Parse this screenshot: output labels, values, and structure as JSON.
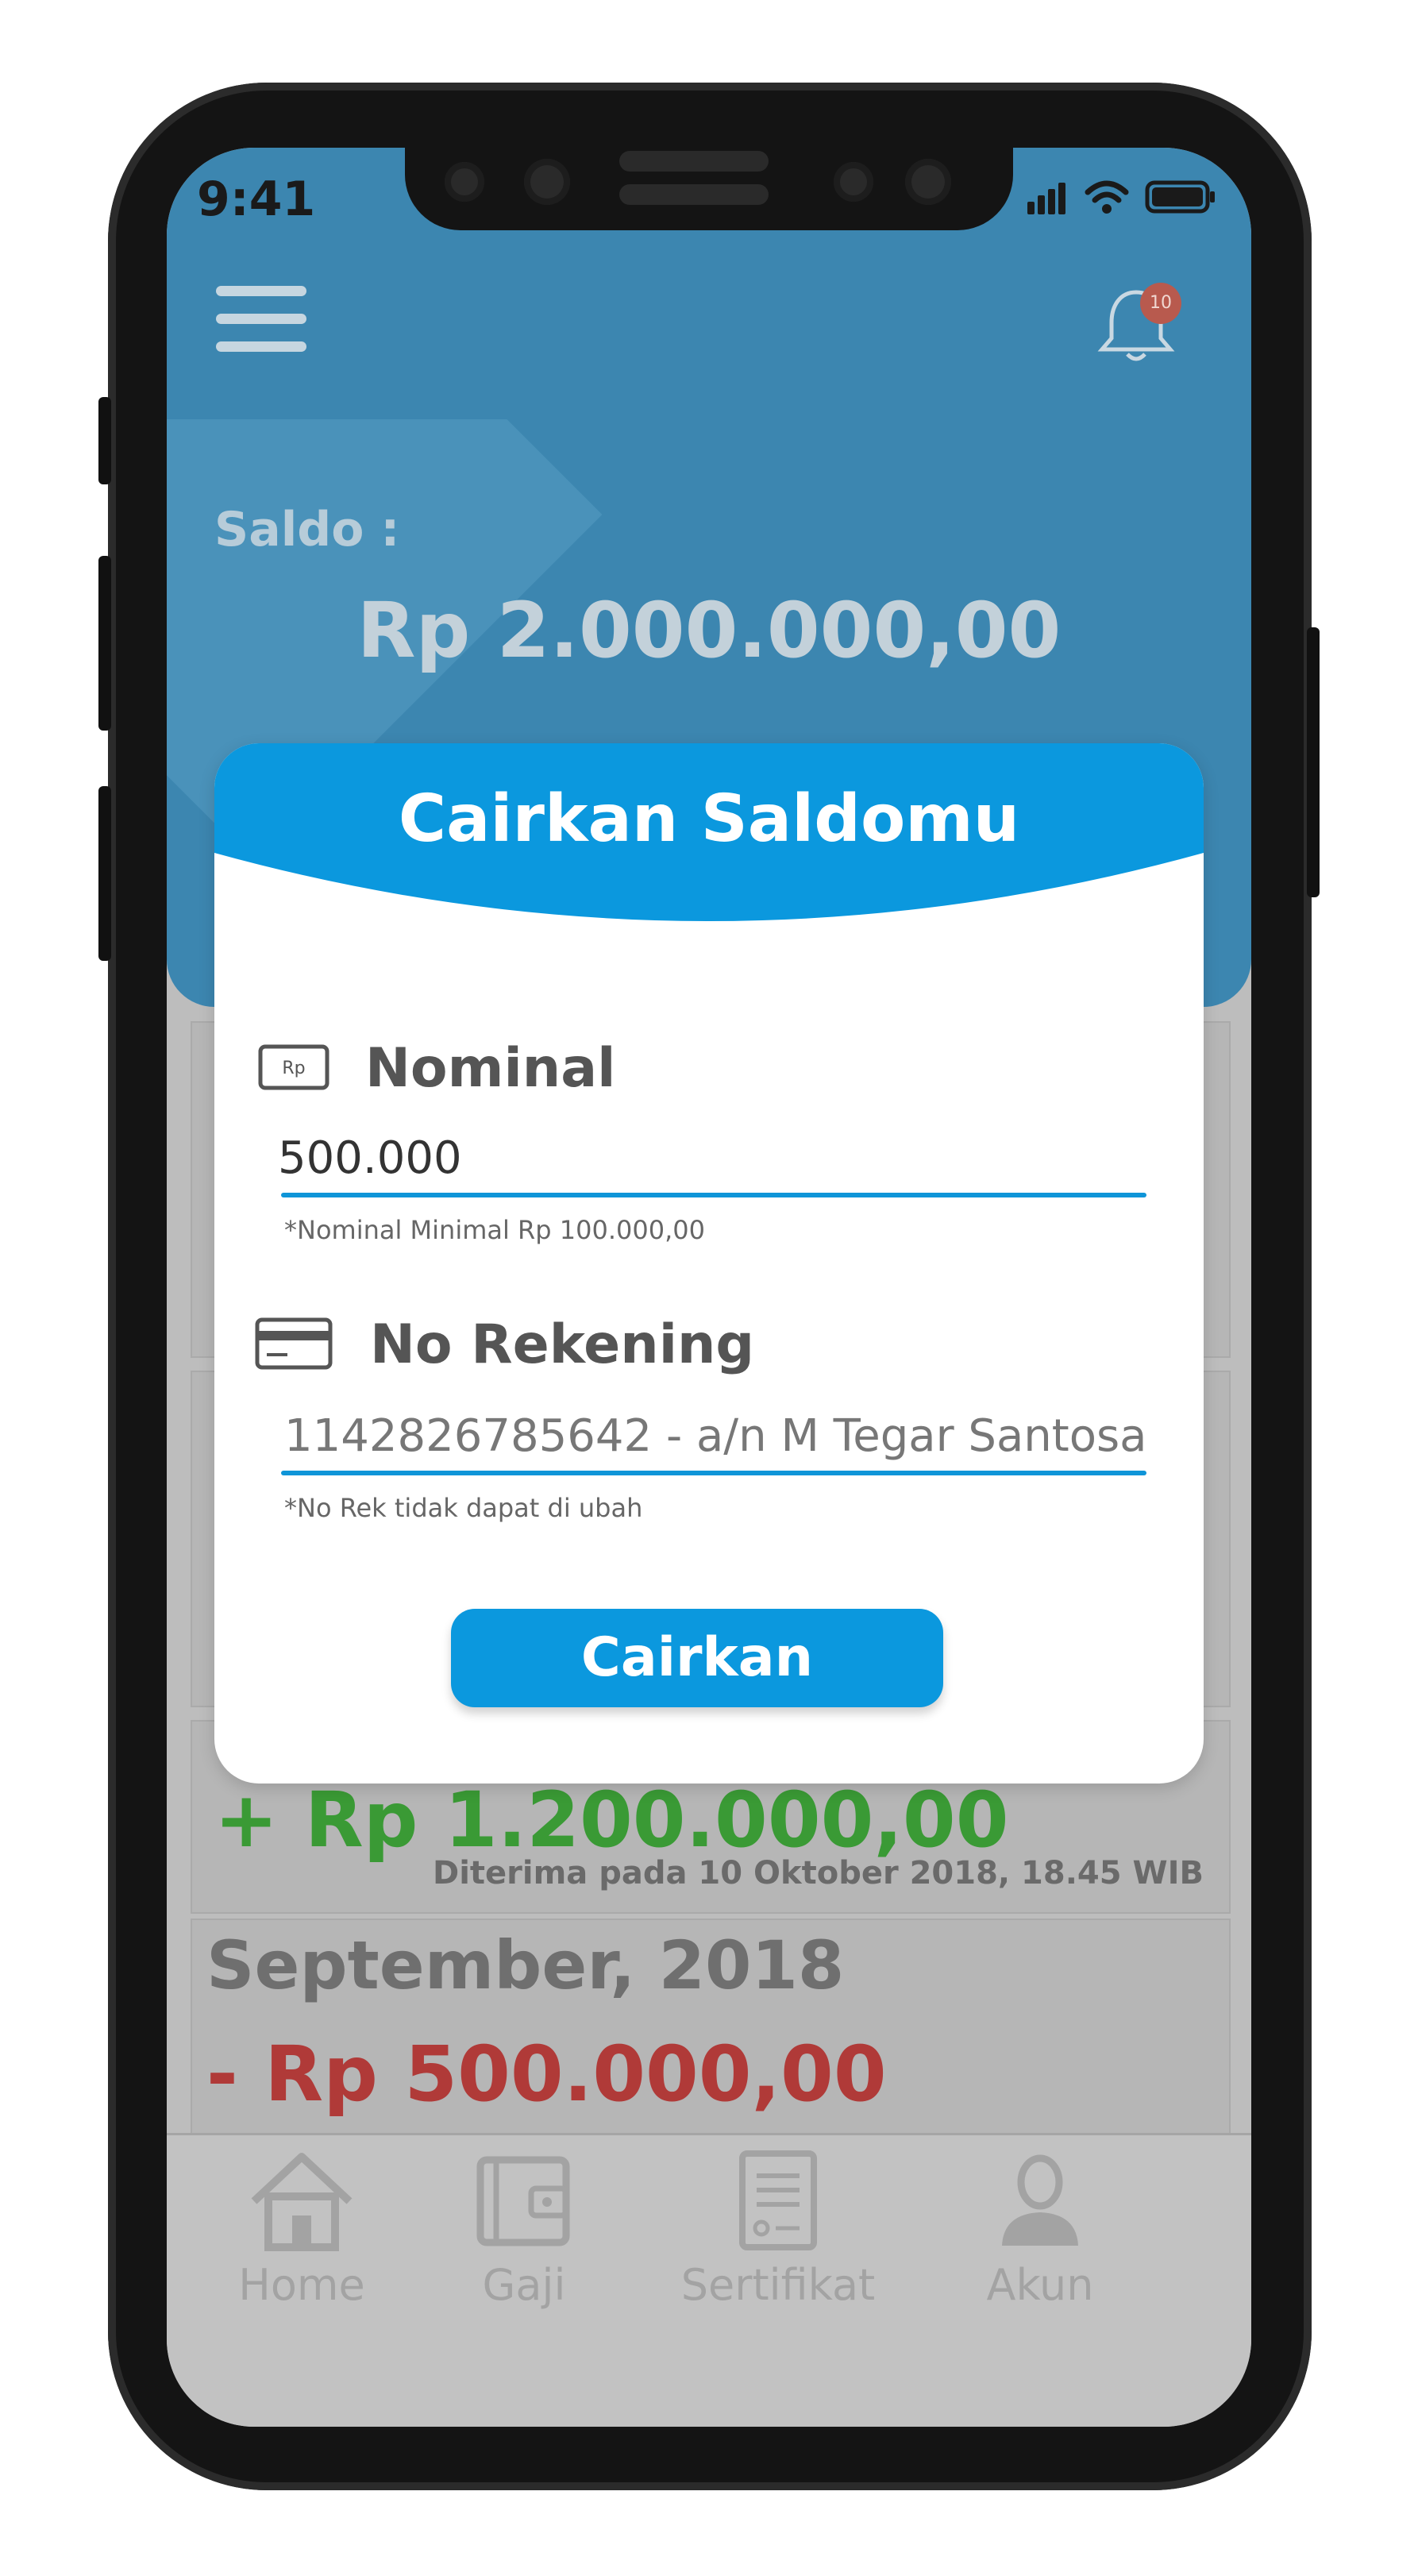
{
  "status_bar": {
    "time": "9:41"
  },
  "header": {
    "notification_count": "10"
  },
  "balance": {
    "label": "Saldo :",
    "amount": "Rp 2.000.000,00"
  },
  "history": [
    {
      "amount": "+ Rp 1.200.000,00",
      "received": "Diterima pada 10 Oktober 2018, 18.45 WIB"
    },
    {
      "month": "September, 2018",
      "amount": "- Rp 500.000,00"
    }
  ],
  "modal": {
    "title": "Cairkan Saldomu",
    "nominal": {
      "label": "Nominal",
      "value": "500.000",
      "hint": "*Nominal Minimal Rp 100.000,00"
    },
    "rekening": {
      "label": "No Rekening",
      "value": "1142826785642 - a/n M Tegar Santosa",
      "hint": "*No Rek tidak dapat di ubah"
    },
    "submit_label": "Cairkan"
  },
  "bottom_nav": [
    {
      "label": "Home",
      "icon": "home-icon"
    },
    {
      "label": "Gaji",
      "icon": "wallet-icon"
    },
    {
      "label": "Sertifikat",
      "icon": "certificate-icon"
    },
    {
      "label": "Akun",
      "icon": "user-icon"
    }
  ],
  "colors": {
    "primary": "#0b98de",
    "header_dimmed": "#3c86b0",
    "positive": "#3a9a35",
    "negative": "#b03a38"
  }
}
